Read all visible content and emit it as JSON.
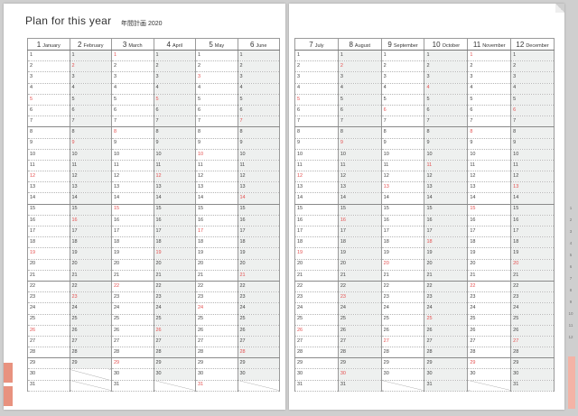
{
  "header": {
    "title": "Plan for this year",
    "subtitle": "年間計画 2020"
  },
  "left_months": [
    {
      "num": "1",
      "name": "January",
      "days": 31
    },
    {
      "num": "2",
      "name": "February",
      "days": 29
    },
    {
      "num": "3",
      "name": "March",
      "days": 31
    },
    {
      "num": "4",
      "name": "April",
      "days": 30
    },
    {
      "num": "5",
      "name": "May",
      "days": 31
    },
    {
      "num": "6",
      "name": "June",
      "days": 30
    }
  ],
  "right_months": [
    {
      "num": "7",
      "name": "July",
      "days": 31
    },
    {
      "num": "8",
      "name": "August",
      "days": 31
    },
    {
      "num": "9",
      "name": "September",
      "days": 30
    },
    {
      "num": "10",
      "name": "October",
      "days": 31
    },
    {
      "num": "11",
      "name": "November",
      "days": 30
    },
    {
      "num": "12",
      "name": "December",
      "days": 31
    }
  ],
  "sidebar_marks": [
    "1",
    "2",
    "3",
    "4",
    "5",
    "6",
    "7",
    "8",
    "9",
    "10",
    "11",
    "12"
  ],
  "colors": {
    "sunday": "#e45050",
    "weekend_shade": "#eef0ef",
    "tab": "#e8927f"
  }
}
